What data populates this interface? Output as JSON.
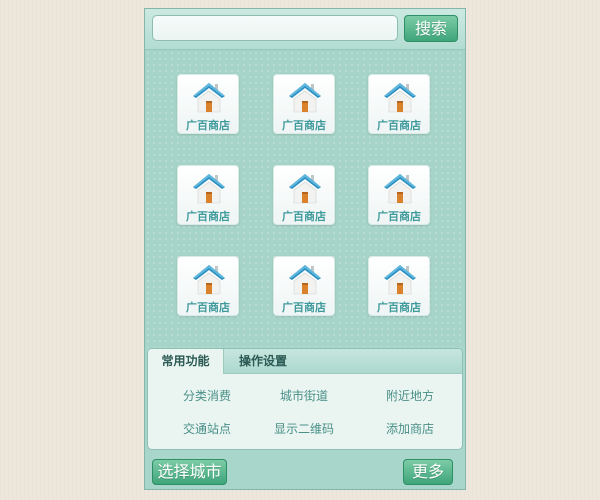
{
  "search": {
    "value": "",
    "placeholder": "",
    "button_label": "搜索"
  },
  "apps": [
    {
      "label": "广百商店",
      "icon": "house-icon"
    },
    {
      "label": "广百商店",
      "icon": "house-icon"
    },
    {
      "label": "广百商店",
      "icon": "house-icon"
    },
    {
      "label": "广百商店",
      "icon": "house-icon"
    },
    {
      "label": "广百商店",
      "icon": "house-icon"
    },
    {
      "label": "广百商店",
      "icon": "house-icon"
    },
    {
      "label": "广百商店",
      "icon": "house-icon"
    },
    {
      "label": "广百商店",
      "icon": "house-icon"
    },
    {
      "label": "广百商店",
      "icon": "house-icon"
    }
  ],
  "tabs": [
    {
      "label": "常用功能",
      "active": true
    },
    {
      "label": "操作设置",
      "active": false
    }
  ],
  "functions": [
    {
      "label": "分类消费"
    },
    {
      "label": "城市街道"
    },
    {
      "label": "附近地方"
    },
    {
      "label": "交通站点"
    },
    {
      "label": "显示二维码"
    },
    {
      "label": "添加商店"
    }
  ],
  "bottom": {
    "city_button": "选择城市",
    "more_button": "更多"
  },
  "colors": {
    "page_background": "#ede6db",
    "panel_background": "#a6d4c8",
    "button_green": "#3ea57a",
    "tile_label": "#3f9a9c",
    "roof_blue": "#2b8fc2",
    "door_orange": "#d9822b"
  }
}
